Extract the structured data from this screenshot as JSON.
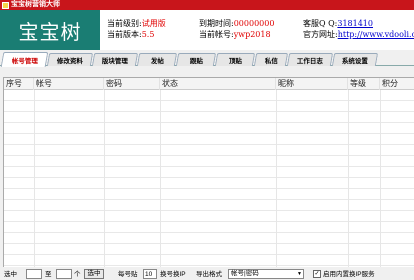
{
  "window": {
    "title": "宝宝树营销大师"
  },
  "header": {
    "logo_text": "宝宝树",
    "level_label": "当前级别:",
    "level_value": "试用版",
    "version_label": "当前版本:",
    "version_value": "5.5",
    "expire_label": "到期时间:",
    "expire_value": "00000000",
    "account_label": "当前帐号:",
    "account_value": "ywp2018",
    "qq_label": "客服Q Q:",
    "qq_value": "3181410",
    "site_label": "官方网址:",
    "site_value": "http://www.vdooli.co"
  },
  "tabs": [
    {
      "label": "帐号管理",
      "active": true
    },
    {
      "label": "修改资料",
      "active": false
    },
    {
      "label": "版块管理",
      "active": false
    },
    {
      "label": "发帖",
      "active": false
    },
    {
      "label": "跟贴",
      "active": false
    },
    {
      "label": "顶贴",
      "active": false
    },
    {
      "label": "私信",
      "active": false
    },
    {
      "label": "工作日志",
      "active": false
    },
    {
      "label": "系统设置",
      "active": false
    }
  ],
  "grid": {
    "columns": [
      "序号",
      "帐号",
      "密码",
      "状态",
      "昵称",
      "等级",
      "积分"
    ],
    "rows": []
  },
  "footer": {
    "select_label": "选中",
    "from_value": "",
    "to_label": "至",
    "to_value": "",
    "count_label": "个",
    "select_button": "选中",
    "per_account_label": "每号贴",
    "per_account_value": "10",
    "switch_ip_label": "换号换IP",
    "export_label": "导出格式",
    "export_format": "帐号|密码",
    "auto_ip_label": "启用内置换IP服务",
    "auto_ip_checked": true
  }
}
